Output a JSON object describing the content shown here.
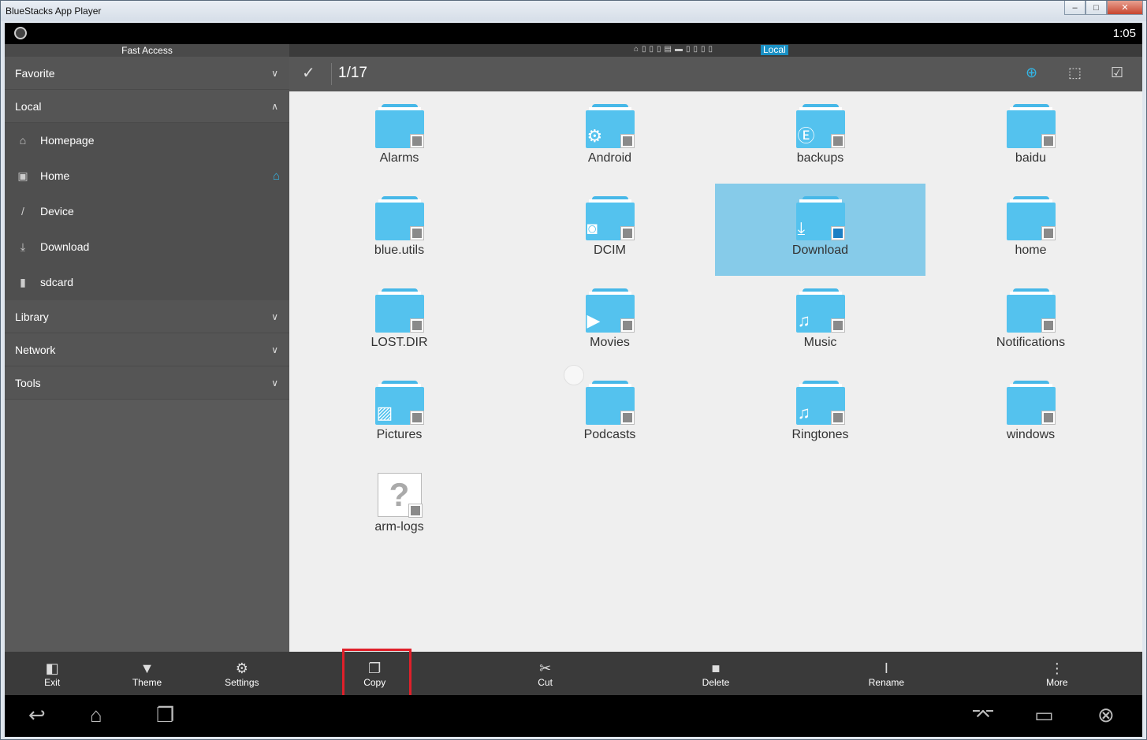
{
  "window": {
    "title": "BlueStacks App Player",
    "minimize": "–",
    "maximize": "□",
    "close": "✕"
  },
  "status": {
    "clock": "1:05"
  },
  "sidebar": {
    "header": "Fast Access",
    "sections": {
      "favorite": "Favorite",
      "local": "Local",
      "library": "Library",
      "network": "Network",
      "tools": "Tools"
    },
    "local_items": {
      "homepage": "Homepage",
      "home": "Home",
      "device": "Device",
      "download": "Download",
      "sdcard": "sdcard"
    },
    "toolbar": {
      "exit": "Exit",
      "theme": "Theme",
      "settings": "Settings"
    }
  },
  "path": {
    "current": "Local"
  },
  "selection": {
    "count": "1/17"
  },
  "files": {
    "f0": "Alarms",
    "f1": "Android",
    "f2": "backups",
    "f3": "baidu",
    "f4": "blue.utils",
    "f5": "DCIM",
    "f6": "Download",
    "f7": "home",
    "f8": "LOST.DIR",
    "f9": "Movies",
    "f10": "Music",
    "f11": "Notifications",
    "f12": "Pictures",
    "f13": "Podcasts",
    "f14": "Ringtones",
    "f15": "windows",
    "f16": "arm-logs"
  },
  "selected_file": "Download",
  "actions": {
    "copy": "Copy",
    "cut": "Cut",
    "delete": "Delete",
    "rename": "Rename",
    "more": "More"
  },
  "colors": {
    "folder": "#54c2ee",
    "selection": "#86cbe9",
    "accent": "#33b5e5",
    "highlight": "#e0202a"
  }
}
